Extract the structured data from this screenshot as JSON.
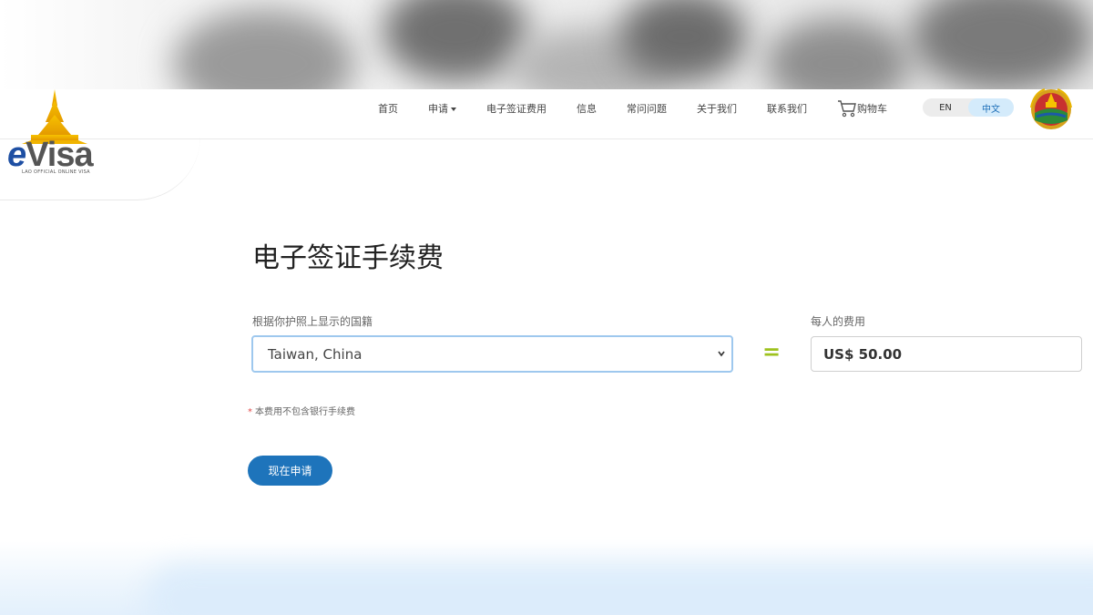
{
  "header": {
    "logo_text": "eVisa",
    "logo_subtitle": "LAO OFFICIAL ONLINE VISA",
    "nav": [
      {
        "label": "首页"
      },
      {
        "label": "申请",
        "has_caret": true
      },
      {
        "label": "电子签证费用"
      },
      {
        "label": "信息"
      },
      {
        "label": "常问问题"
      },
      {
        "label": "关于我们"
      },
      {
        "label": "联系我们"
      }
    ],
    "cart_label": "购物车",
    "lang": {
      "en": "EN",
      "zh": "中文",
      "active": "zh"
    }
  },
  "main": {
    "title": "电子签证手续费",
    "nationality_label": "根据你护照上显示的国籍",
    "nationality_value": "Taiwan, China",
    "equals": "=",
    "fee_label": "每人的费用",
    "fee_value": "US$ 50.00",
    "note": "本费用不包含银行手续费",
    "apply_label": "现在申请"
  },
  "colors": {
    "accent": "#1e74bb",
    "equals": "#9ec21e",
    "star": "#e24a4a"
  }
}
